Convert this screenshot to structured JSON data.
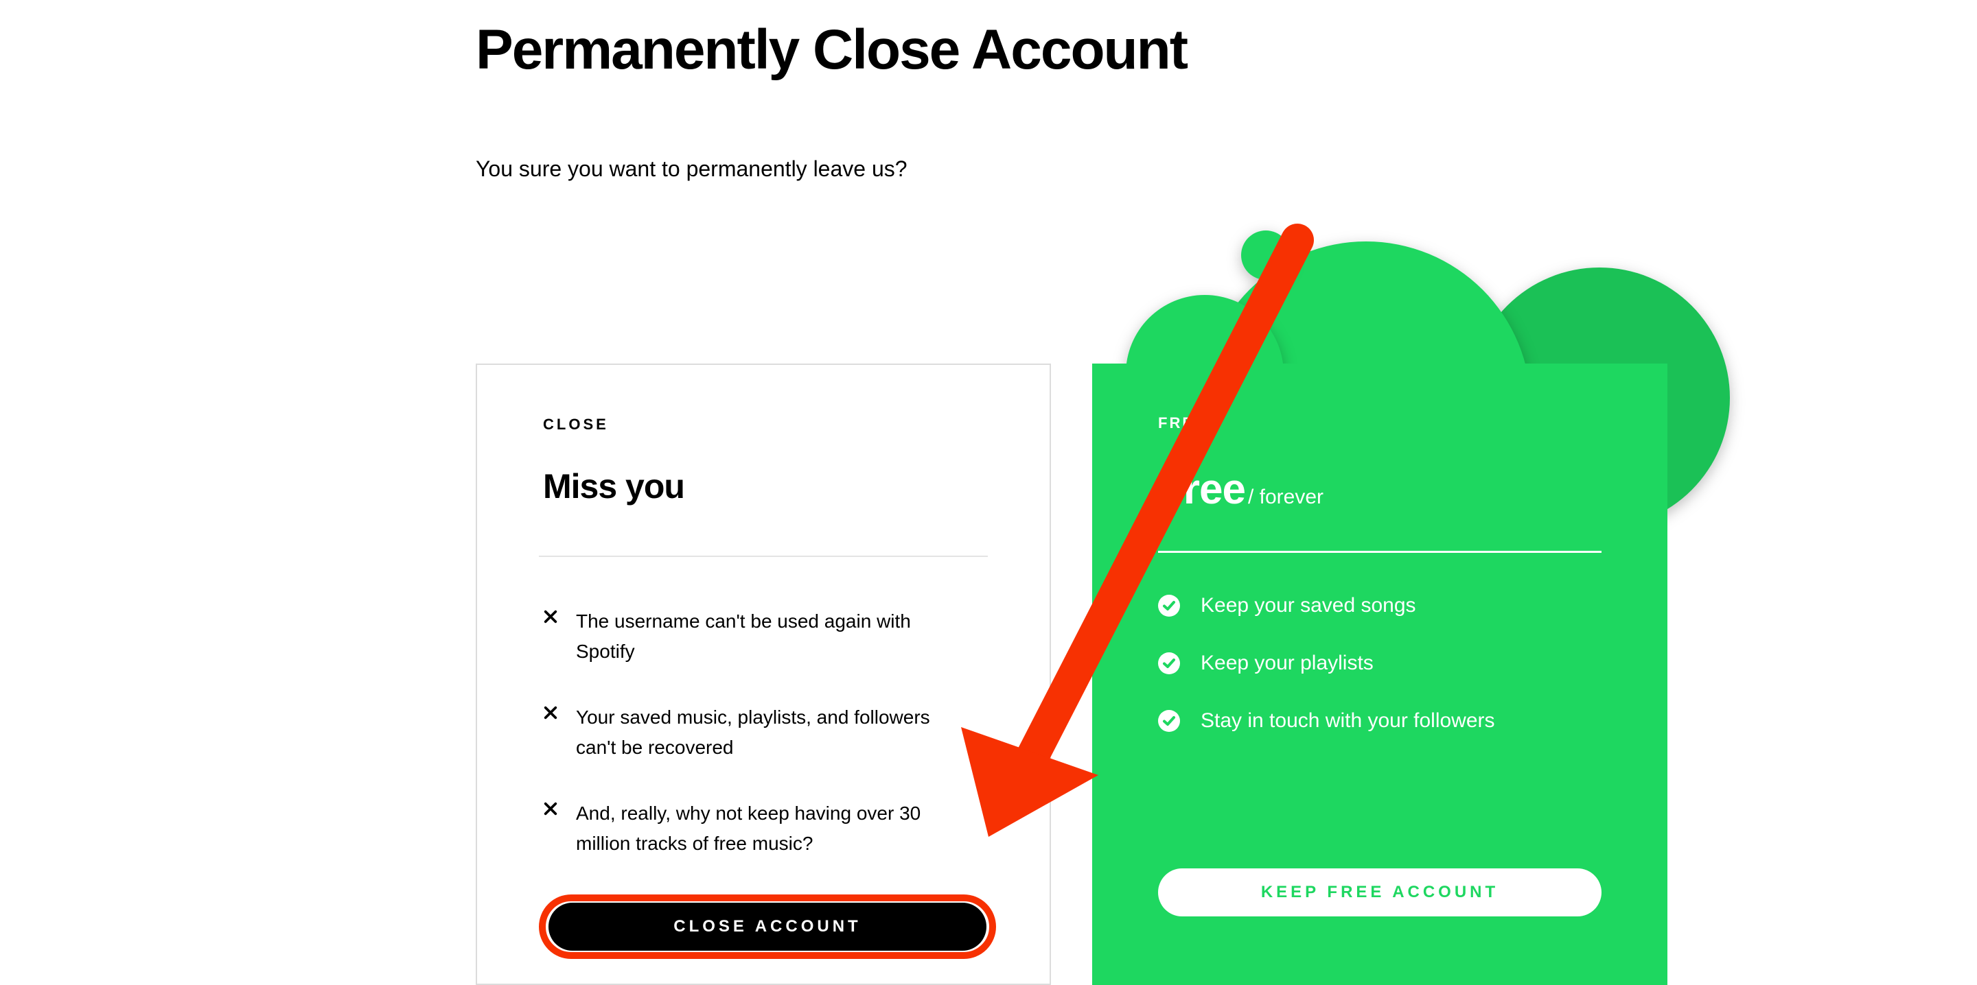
{
  "page": {
    "title": "Permanently Close Account",
    "subtitle": "You sure you want to permanently leave us?"
  },
  "closePanel": {
    "label": "CLOSE",
    "heading": "Miss you",
    "items": [
      "The username can't be used again with Spotify",
      "Your saved music, playlists, and followers can't be recovered",
      "And, really, why not keep having over 30 million tracks of free music?"
    ],
    "button": "CLOSE ACCOUNT"
  },
  "freePanel": {
    "label": "FREE",
    "title": "Free",
    "suffix": "/ forever",
    "items": [
      "Keep your saved songs",
      "Keep your playlists",
      "Stay in touch with your followers"
    ],
    "button": "KEEP FREE ACCOUNT"
  },
  "colors": {
    "accent": "#1ed760",
    "accentDark": "#1bc156",
    "annotation": "#f73102"
  }
}
